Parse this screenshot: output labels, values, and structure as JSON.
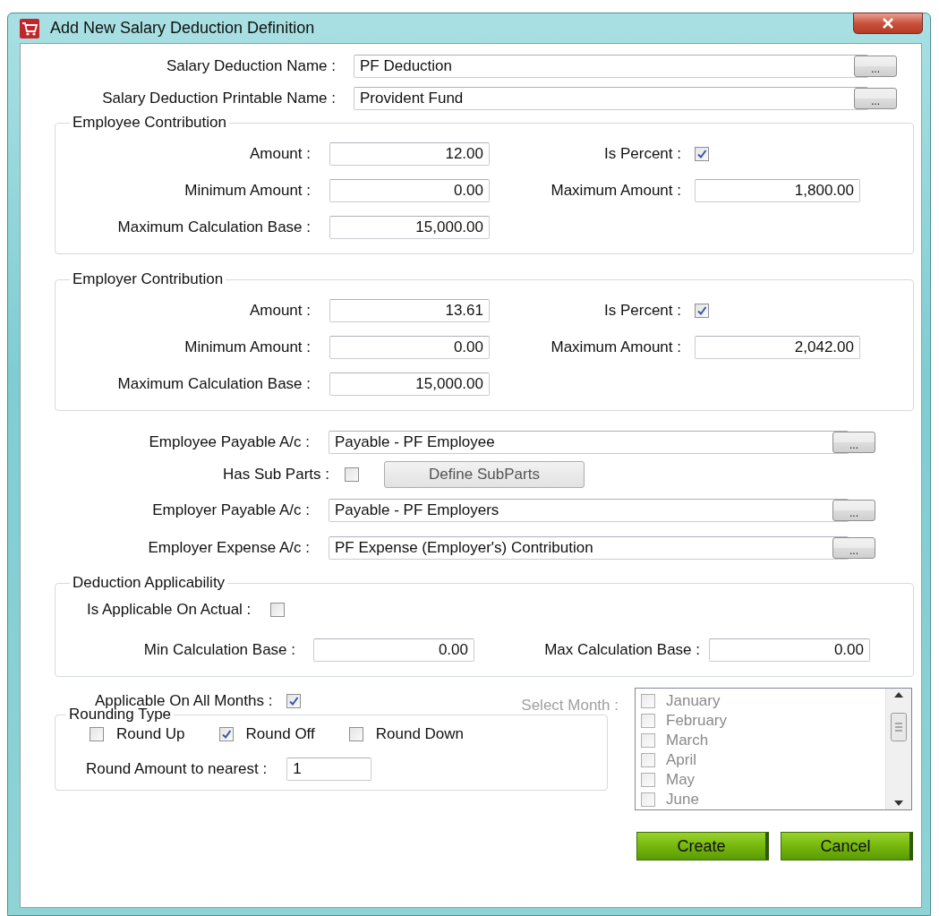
{
  "window": {
    "title": "Add New Salary Deduction Definition"
  },
  "name_fields": [
    {
      "label": "Salary Deduction Name :",
      "value": "PF Deduction",
      "button": "..."
    },
    {
      "label": "Salary Deduction Printable Name :",
      "value": "Provident Fund",
      "button": "..."
    }
  ],
  "contribution_groups": [
    {
      "title": "Employee Contribution",
      "amount_label": "Amount :",
      "amount": "12.00",
      "percent_label": "Is Percent :",
      "is_percent": true,
      "min_label": "Minimum Amount :",
      "min": "0.00",
      "max_label": "Maximum Amount :",
      "max": "1,800.00",
      "base_label": "Maximum Calculation Base :",
      "base": "15,000.00"
    },
    {
      "title": "Employer Contribution",
      "amount_label": "Amount :",
      "amount": "13.61",
      "percent_label": "Is Percent :",
      "is_percent": true,
      "min_label": "Minimum Amount :",
      "min": "0.00",
      "max_label": "Maximum Amount :",
      "max": "2,042.00",
      "base_label": "Maximum Calculation Base :",
      "base": "15,000.00"
    }
  ],
  "accounts": [
    {
      "kind": "lookup",
      "label": "Employee Payable A/c :",
      "value": "Payable - PF Employee",
      "button": "..."
    },
    {
      "kind": "subparts",
      "label": "Has Sub Parts :",
      "checked": false,
      "button": "Define SubParts"
    },
    {
      "kind": "lookup",
      "label": "Employer Payable A/c :",
      "value": "Payable - PF Employers",
      "button": "..."
    },
    {
      "kind": "lookup",
      "label": "Employer Expense A/c :",
      "value": "PF Expense (Employer's) Contribution",
      "button": "..."
    }
  ],
  "applicability": {
    "title": "Deduction Applicability",
    "actual_label": "Is Applicable On Actual :",
    "on_actual": false,
    "min_label": "Min Calculation Base :",
    "min": "0.00",
    "max_label": "Max Calculation Base :",
    "max": "0.00"
  },
  "all_months": {
    "label": "Applicable On All Months :",
    "checked": true
  },
  "rounding": {
    "title": "Rounding Type",
    "options": [
      {
        "label": "Round Up",
        "checked": false
      },
      {
        "label": "Round Off",
        "checked": true
      },
      {
        "label": "Round Down",
        "checked": false
      }
    ],
    "nearest_label": "Round Amount to nearest :",
    "nearest": "1"
  },
  "month_selector": {
    "label": "Select Month :",
    "disabled": true,
    "months": [
      {
        "label": "January",
        "checked": false
      },
      {
        "label": "February",
        "checked": false
      },
      {
        "label": "March",
        "checked": false
      },
      {
        "label": "April",
        "checked": false
      },
      {
        "label": "May",
        "checked": false
      },
      {
        "label": "June",
        "checked": false
      }
    ]
  },
  "buttons": [
    "Create",
    "Cancel"
  ]
}
